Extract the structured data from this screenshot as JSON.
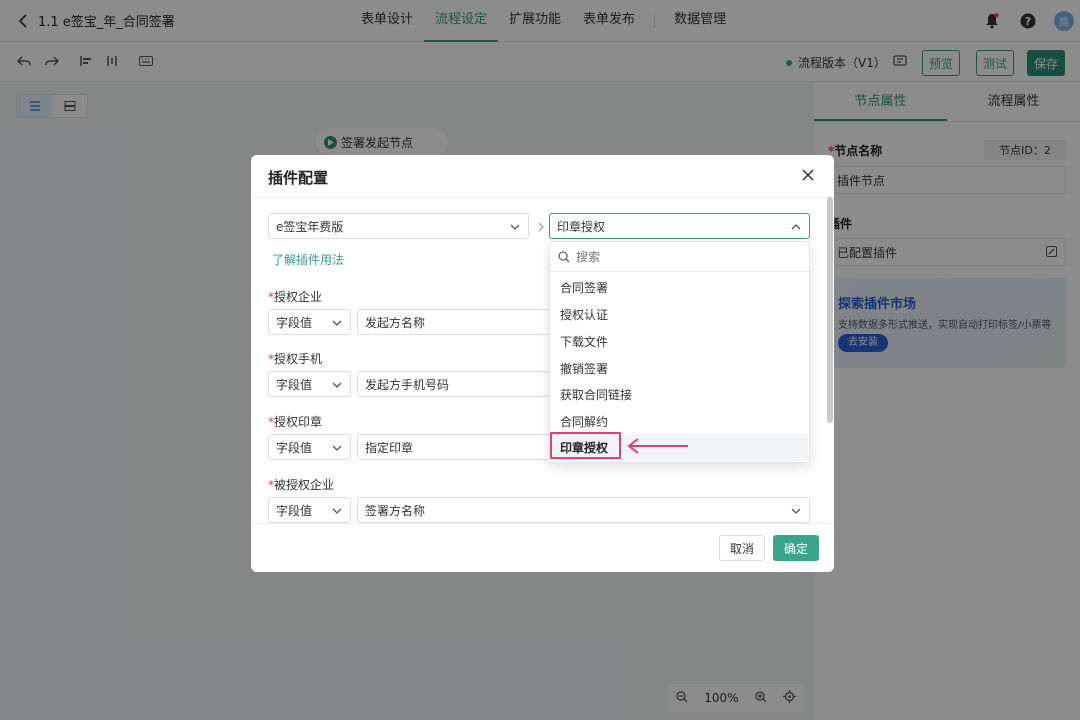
{
  "header": {
    "title": "1.1 e签宝_年_合同签署",
    "tabs": [
      {
        "label": "表单设计",
        "active": false
      },
      {
        "label": "流程设定",
        "active": true
      },
      {
        "label": "扩展功能",
        "active": false
      },
      {
        "label": "表单发布",
        "active": false
      },
      {
        "label": "数据管理",
        "active": false
      }
    ],
    "avatar_text": "简"
  },
  "toolbar": {
    "version_label": "流程版本（V1）",
    "preview_label": "预览",
    "test_label": "测试",
    "save_label": "保存"
  },
  "canvas": {
    "start_node_label": "签署发起节点",
    "zoom_level": "100%"
  },
  "right_panel": {
    "tabs": [
      {
        "label": "节点属性",
        "active": true
      },
      {
        "label": "流程属性",
        "active": false
      }
    ],
    "node_name_label": "节点名称",
    "node_id": "节点ID：2",
    "node_name_value": "插件节点",
    "plugin_label": "插件",
    "plugin_value": "已配置插件",
    "market_title": "探索插件市场",
    "market_desc": "支持数据多形式推送，实现自动打印标签/小票等",
    "market_button": "去安装"
  },
  "modal": {
    "title": "插件配置",
    "plugin_select": "e签宝年费版",
    "action_select": "印章授权",
    "help_link": "了解插件用法",
    "fields": [
      {
        "label": "授权企业",
        "type": "字段值",
        "value": "发起方名称"
      },
      {
        "label": "授权手机",
        "type": "字段值",
        "value": "发起方手机号码"
      },
      {
        "label": "授权印章",
        "type": "字段值",
        "value": "指定印章"
      },
      {
        "label": "被授权企业",
        "type": "字段值",
        "value": "签署方名称"
      }
    ],
    "cancel_label": "取消",
    "ok_label": "确定"
  },
  "dropdown": {
    "search_placeholder": "搜索",
    "options": [
      "合同签署",
      "授权认证",
      "下载文件",
      "撤销签署",
      "获取合同链接",
      "合同解约",
      "印章授权"
    ],
    "selected": "印章授权"
  },
  "colors": {
    "accent": "#3a9a85",
    "highlight": "#e0407a",
    "required": "#ee3333"
  }
}
